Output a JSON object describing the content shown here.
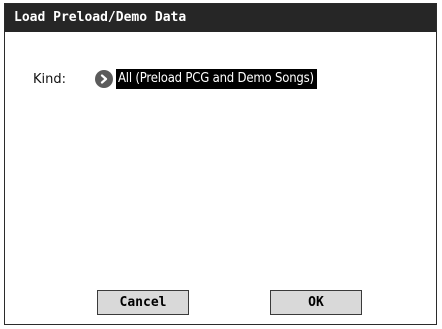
{
  "dialog": {
    "title": "Load Preload/Demo Data",
    "kind_label": "Kind:",
    "kind_value": "All (Preload PCG and Demo Songs)",
    "cancel_label": "Cancel",
    "ok_label": "OK"
  },
  "icons": {
    "popup": "chevron-right-icon"
  },
  "colors": {
    "title_bar": "#262626",
    "selected_value_bg": "#000000",
    "button_bg": "#d9d9d9"
  }
}
